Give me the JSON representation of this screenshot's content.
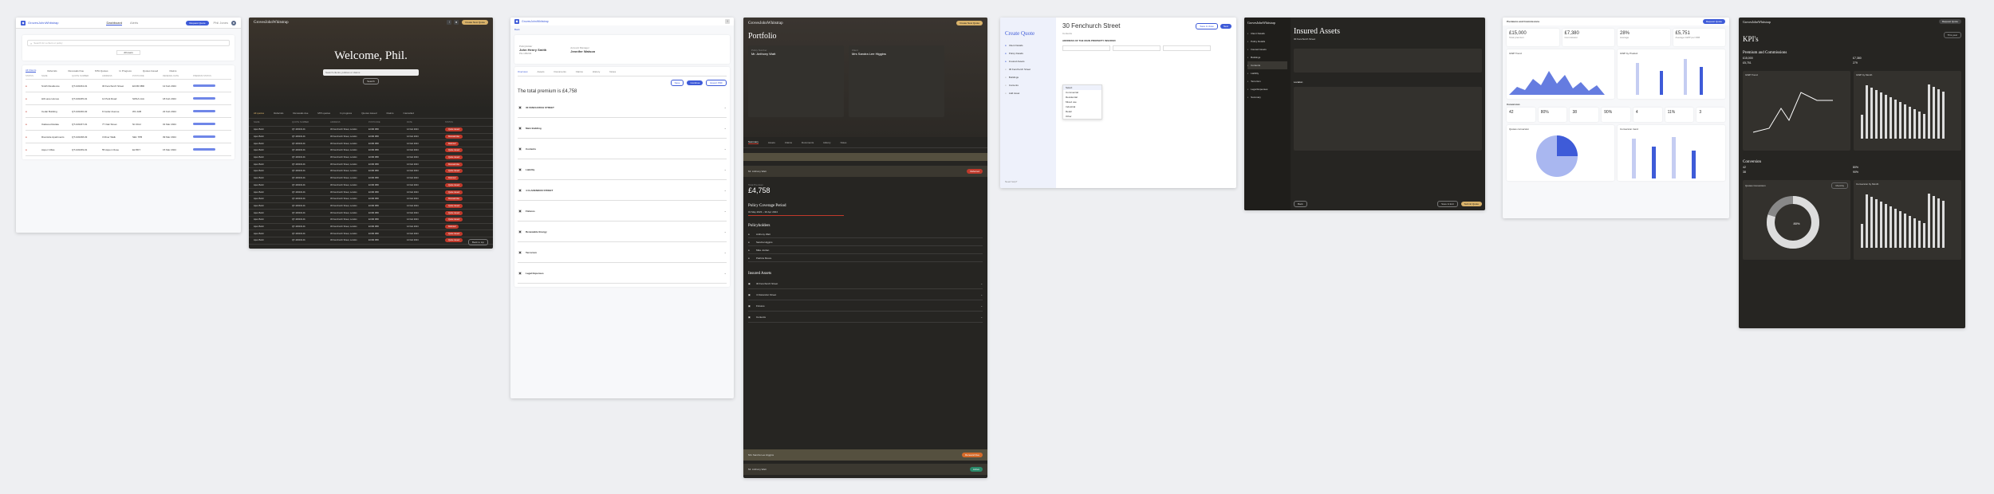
{
  "brand": "GrovesJohnWhitstrap",
  "colors": {
    "accent": "#3e5bd8",
    "dark_bg": "#262522",
    "gold": "#d9b26a",
    "danger": "#c0392b"
  },
  "s1": {
    "nav": [
      "Dashboard",
      "Alerts"
    ],
    "button": "Request Quote",
    "user": "Phil Jones",
    "search_placeholder": "Search for a client or policy",
    "filter": "All users",
    "tabs": [
      "All Clients",
      "Referrals",
      "Renewals Due",
      "MTA Quotes",
      "In Progress",
      "Quotes Issued",
      "Claims"
    ],
    "headers": [
      "STATUS",
      "NAME",
      "QUOTE NUMBER",
      "ADDRESS",
      "POSTCODE",
      "RENEWAL DATE",
      "PREMIUM STATUS"
    ],
    "rows": [
      {
        "name": "Smith Residence",
        "quote": "QT-100234-01",
        "address": "30 Fenchurch Street",
        "postcode": "EC3M 3BD",
        "date": "12 Feb 2024"
      },
      {
        "name": "Hill Lane Homes",
        "quote": "QT-100235-01",
        "address": "14 Park Road",
        "postcode": "SW1A 1AA",
        "date": "18 Feb 2024"
      },
      {
        "name": "Cedar Building",
        "quote": "QT-100236-02",
        "address": "9 Cedar Avenue",
        "postcode": "W1 2AB",
        "date": "22 Feb 2024"
      },
      {
        "name": "Oakwood Estate",
        "quote": "QT-100237-01",
        "address": "77 Oak Street",
        "postcode": "N1 9GU",
        "date": "01 Mar 2024"
      },
      {
        "name": "Riverside Apartments",
        "quote": "QT-100238-03",
        "address": "3 River Walk",
        "postcode": "SE1 7PB",
        "date": "09 Mar 2024"
      },
      {
        "name": "Aspen Villas",
        "quote": "QT-100239-01",
        "address": "55 Aspen Close",
        "postcode": "E2 8DY",
        "date": "15 Mar 2024"
      }
    ]
  },
  "s2": {
    "button": "Create New Quote",
    "welcome": "Welcome, Phil.",
    "search_button": "Search",
    "search_placeholder": "Search clients, policies or claims",
    "tabs": [
      "All quotes",
      "Referrals",
      "Renewals due",
      "MTA quotes",
      "In progress",
      "Quotes issued",
      "Claims",
      "Cancelled"
    ],
    "headers": [
      "NAME",
      "QUOTE NUMBER",
      "ADDRESS",
      "POSTCODE",
      "DATE",
      "STATUS"
    ],
    "rows": [
      "Quote issued",
      "Renewal due",
      "Referred",
      "Quote issued",
      "Quote issued",
      "Renewal due",
      "Quote issued",
      "Referred",
      "Quote issued",
      "Quote issued",
      "Renewal due",
      "Quote issued",
      "Quote issued",
      "Quote issued",
      "Referred",
      "Quote issued",
      "Quote issued"
    ],
    "row_name": "Apex Build",
    "row_quote": "QT-100234-01",
    "row_address": "30 Fenchurch Street, London",
    "row_postcode": "EC3M 3BD",
    "row_date": "12 Feb 2024",
    "footer_button": "Back to top"
  },
  "s3": {
    "back": "Back",
    "brand_title": "GrovesJohnWhitstrap",
    "client_label": "Policyholder",
    "client_name": "John Henry Smith",
    "client_ref": "PH-100234",
    "agent_label": "Account Manager",
    "agent_name": "Jennifer Watson",
    "tabs": [
      "Overview",
      "Assets",
      "Documents",
      "Claims",
      "History",
      "Notes"
    ],
    "premium_title": "The total premium is £4,758",
    "sections": [
      "30 FENCHURCH STREET",
      "Main Building",
      "Contents",
      "Liability",
      "4 CLARENDON STREET",
      "Fixtures",
      "Renewable Energy",
      "Terrorism",
      "Legal Expenses"
    ],
    "buttons": [
      "Save",
      "Continue",
      "Export PDF"
    ]
  },
  "s4": {
    "title": "Portfolio",
    "policy_label": "Policy Number",
    "policy_name": "Mr. Anthony Watt",
    "client_label": "Client",
    "client_name": "Mrs Sandra Lee Higgins",
    "premium_label": "Total Premium",
    "premium": "£4,758",
    "coverage_title": "Policy Coverage Period",
    "coverage_dates": "01 May 2023 – 30 Apr 2024",
    "holders_title": "Policyholders",
    "assets_title": "Insured Assets",
    "tabs": [
      "Summary",
      "Assets",
      "Claims",
      "Documents",
      "History",
      "Notes"
    ],
    "status_referred": "Referred",
    "status_due": "Renewal Due",
    "status_active": "Active",
    "holders": [
      "Anthony Watt",
      "Sandra Higgins",
      "Mike Jordan",
      "Patricia Moore"
    ],
    "assets": [
      "30 Fenchurch Street",
      "4 Clarendon Street",
      "Fixtures",
      "Contents"
    ],
    "button": "Create New Quote"
  },
  "s5": {
    "title": "Create Quote",
    "steps": [
      "Client Details",
      "Policy Details",
      "Insured Assets",
      "30 Fenchurch Street",
      "Buildings",
      "Contents",
      "Add Asset"
    ],
    "address": "30 Fenchurch Street",
    "subtitle": "Contents",
    "buttons": [
      "Save & close",
      "Next"
    ],
    "section_title": "ADDRESS OF THE MAIN PROPERTY INSURED",
    "dropdown_items": [
      "Select",
      "Commercial",
      "Residential",
      "Mixed use",
      "Industrial",
      "Retail",
      "Other"
    ],
    "footer": "Need help?"
  },
  "s6": {
    "title": "Insured Assets",
    "subtitle": "30 Fenchurch Street",
    "sidebar": [
      "Client Details",
      "Policy Details",
      "Insured Assets",
      "Buildings",
      "Contents",
      "Liability",
      "Terrorism",
      "Legal Expenses",
      "Summary"
    ],
    "location_title": "Location",
    "buttons": [
      "Back",
      "Save & Exit",
      "Submit Quote"
    ]
  },
  "s7": {
    "title": "Premiums and Commissions",
    "button": "Request Quote",
    "kpis": [
      "£15,000",
      "£7,380",
      "28%",
      "£5,751"
    ],
    "kpi_labels": [
      "Total premium",
      "Commission",
      "Average",
      "Average GWP per RIM"
    ],
    "chart1": "GWP Trend",
    "chart2": "GWP by Product",
    "conversion_title": "Conversion",
    "kpis2": [
      "42",
      "80%",
      "38",
      "90%",
      "4",
      "11%",
      "3"
    ],
    "chart3": "Quotes conversion",
    "chart4": "Conversion trend"
  },
  "s8": {
    "title": "KPI's",
    "button1": "Request Quote",
    "filter": "This year",
    "section1": "Premium and Commissions",
    "v1": "£15,000",
    "v2": "£7,380",
    "v3": "£5,751",
    "v4": "279",
    "section2": "Conversion",
    "c1": "42",
    "c2": "80%",
    "c3": "38",
    "c4": "90%",
    "chart1": "GWP Trend",
    "chart2": "GWP by Month",
    "chart3": "Quotes Conversion",
    "chart4": "Conversion by Month",
    "donut_value": "80%",
    "filter2": "Monthly"
  }
}
